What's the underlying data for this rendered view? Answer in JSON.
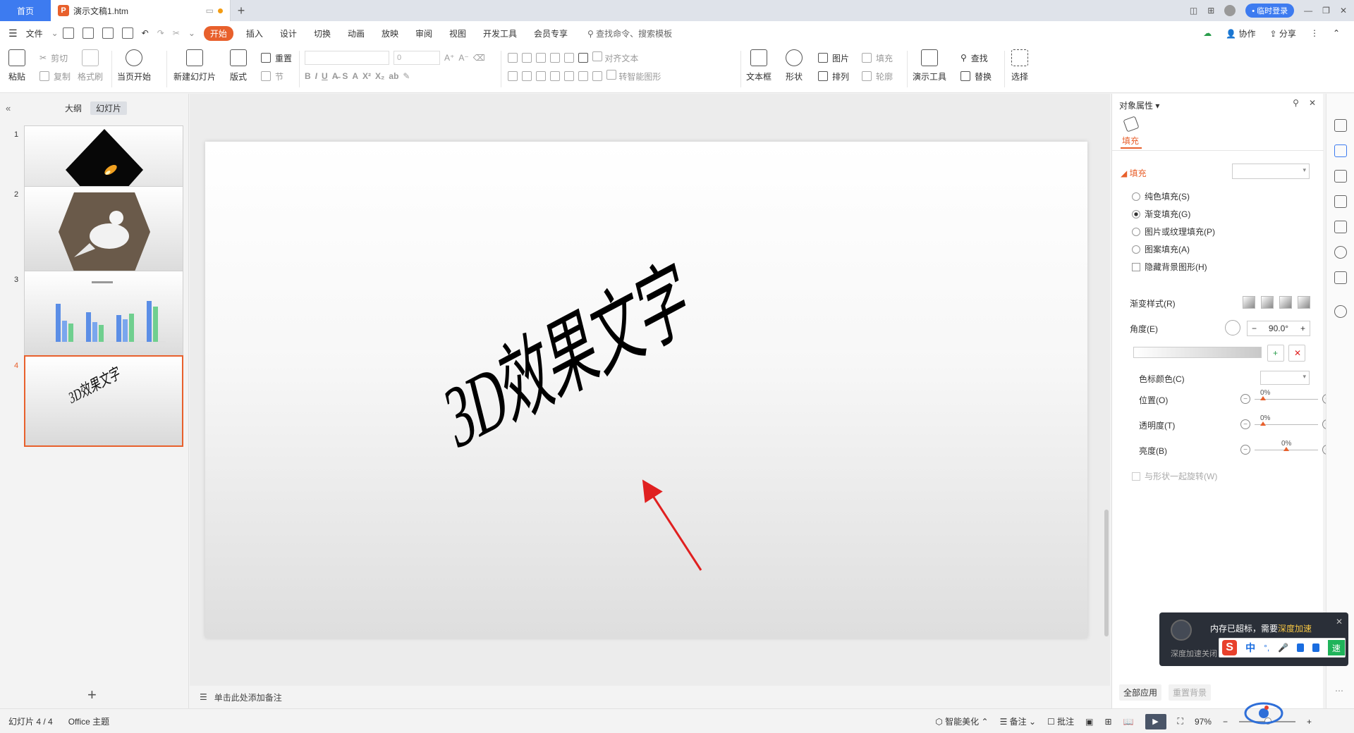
{
  "titlebar": {
    "home_tab": "首页",
    "doc_tab": "演示文稿1.htm",
    "login_button": "• 临时登录"
  },
  "menubar": {
    "file": "文件",
    "items": [
      "开始",
      "插入",
      "设计",
      "切换",
      "动画",
      "放映",
      "审阅",
      "视图",
      "开发工具",
      "会员专享"
    ],
    "active_index": 0,
    "search_placeholder": "查找命令、搜索模板",
    "collab": "协作",
    "share": "分享"
  },
  "ribbon": {
    "paste": "粘贴",
    "cut": "剪切",
    "copy": "复制",
    "format_painter": "格式刷",
    "slideshow_from_current": "当页开始",
    "new_slide": "新建幻灯片",
    "layout": "版式",
    "reset": "重置",
    "section": "节",
    "font_size": "0",
    "align_text": "对齐文本",
    "smartart": "转智能图形",
    "textbox": "文本框",
    "shape": "形状",
    "picture": "图片",
    "arrange": "排列",
    "fill": "填充",
    "outline": "轮廓",
    "present_tools": "演示工具",
    "find": "查找",
    "replace": "替换",
    "select": "选择"
  },
  "left_panel": {
    "tab_outline": "大纲",
    "tab_slides": "幻灯片",
    "slide_numbers": [
      "1",
      "2",
      "3",
      "4"
    ],
    "selected_slide": 4,
    "thumb4_text": "3D效果文字"
  },
  "slide": {
    "text": "3D效果文字"
  },
  "notes_placeholder": "单击此处添加备注",
  "right_panel": {
    "title": "对象属性",
    "tab_fill": "填充",
    "section_fill": "填充",
    "options": [
      "纯色填充(S)",
      "渐变填充(G)",
      "图片或纹理填充(P)",
      "图案填充(A)"
    ],
    "selected_option": 1,
    "hide_bg": "隐藏背景图形(H)",
    "gradient_style": "渐变样式(R)",
    "angle_label": "角度(E)",
    "angle_value": "90.0°",
    "stop_color": "色标颜色(C)",
    "position": "位置(O)",
    "position_value": "0%",
    "transparency": "透明度(T)",
    "transparency_value": "0%",
    "brightness": "亮度(B)",
    "brightness_value": "0%",
    "rotate_with_shape": "与形状一起旋转(W)",
    "apply_all": "全部应用",
    "reset_bg": "重置背景"
  },
  "popup": {
    "message_prefix": "内存已超标，需要",
    "message_link": "深度加速",
    "sub": "深度加速关闭"
  },
  "ime": {
    "zh": "中",
    "green_btn": "速"
  },
  "statusbar": {
    "slide_count": "幻灯片 4 / 4",
    "theme": "Office 主题",
    "beautify": "智能美化",
    "notes": "备注",
    "comments": "批注",
    "zoom": "97%"
  },
  "colors": {
    "accent": "#e8602c",
    "title_blue": "#3d7bf0",
    "arrow_red": "#e02020"
  }
}
